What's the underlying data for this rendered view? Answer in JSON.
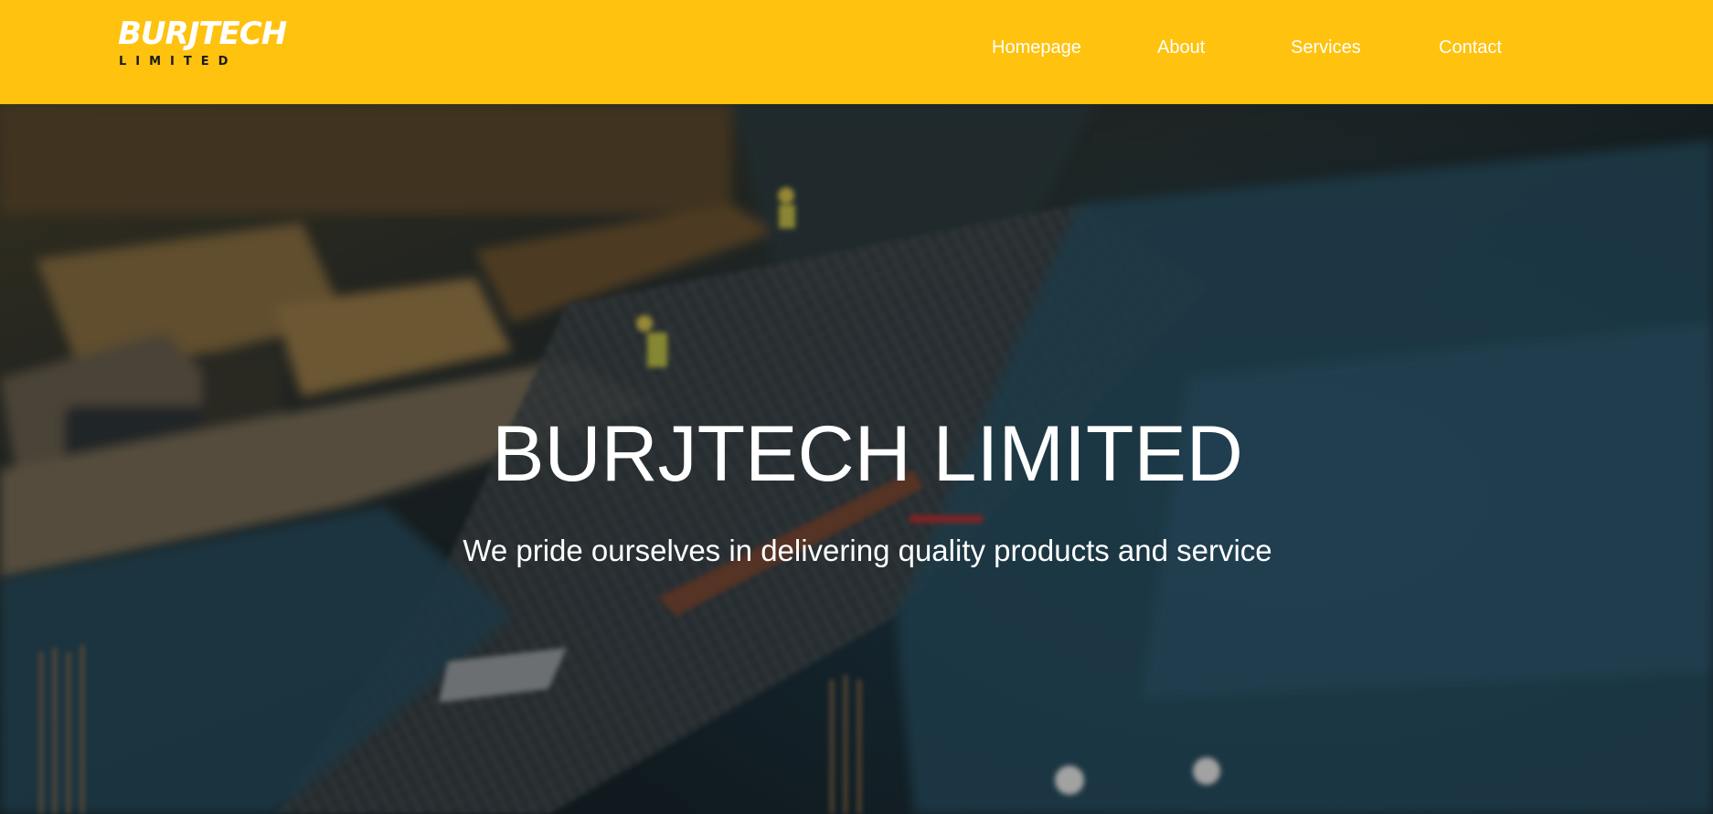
{
  "header": {
    "logo_main": "BURJTECH",
    "logo_sub": "LIMITED",
    "background_color": "#ffc20e",
    "nav": [
      {
        "label": "Homepage"
      },
      {
        "label": "About"
      },
      {
        "label": "Services"
      },
      {
        "label": "Contact"
      }
    ]
  },
  "hero": {
    "title": "BURJTECH LIMITED",
    "subtitle": "We pride ourselves in delivering quality products and service"
  }
}
